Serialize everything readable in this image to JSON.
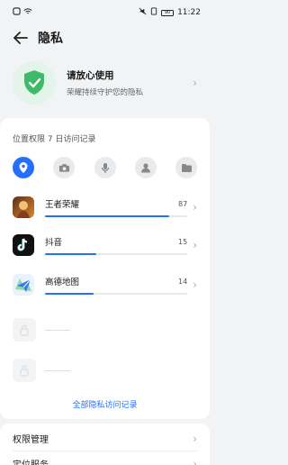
{
  "status": {
    "time": "11:22",
    "battery": "90"
  },
  "header": {
    "title": "隐私"
  },
  "safety": {
    "title": "请放心使用",
    "subtitle": "荣耀持续守护您的隐私"
  },
  "records": {
    "section_title": "位置权限 7 日访问记录",
    "tabs": [
      {
        "icon": "location-icon",
        "active": true
      },
      {
        "icon": "camera-icon",
        "active": false
      },
      {
        "icon": "microphone-icon",
        "active": false
      },
      {
        "icon": "contacts-icon",
        "active": false
      },
      {
        "icon": "folder-icon",
        "active": false
      }
    ],
    "apps": [
      {
        "name": "王者荣耀",
        "count": "87",
        "progress": 0.87,
        "color": "#d98a2b"
      },
      {
        "name": "抖音",
        "count": "15",
        "progress": 0.36,
        "color": "#111111"
      },
      {
        "name": "高德地图",
        "count": "14",
        "progress": 0.34,
        "color": "#3b82f6"
      }
    ],
    "all_link": "全部隐私访问记录"
  },
  "menu": {
    "item1": "权限管理",
    "item2": "定位服务"
  }
}
